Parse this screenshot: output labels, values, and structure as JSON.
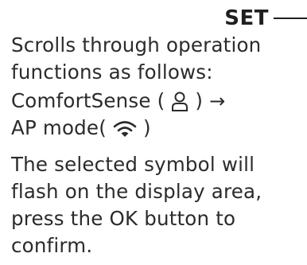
{
  "header": {
    "label": "SET"
  },
  "intro": {
    "line1": "Scrolls through operation",
    "line2": "functions as follows:"
  },
  "modes": {
    "comfort_label": "ComfortSense (",
    "comfort_close": ")",
    "arrow": "→",
    "ap_label": "AP mode(",
    "ap_close": ")",
    "comfort_icon": "person-icon",
    "ap_icon": "wifi-icon"
  },
  "note": {
    "line1": "The selected symbol will",
    "line2": "flash on the display area,",
    "line3": "press the OK button to",
    "line4": "confirm."
  }
}
